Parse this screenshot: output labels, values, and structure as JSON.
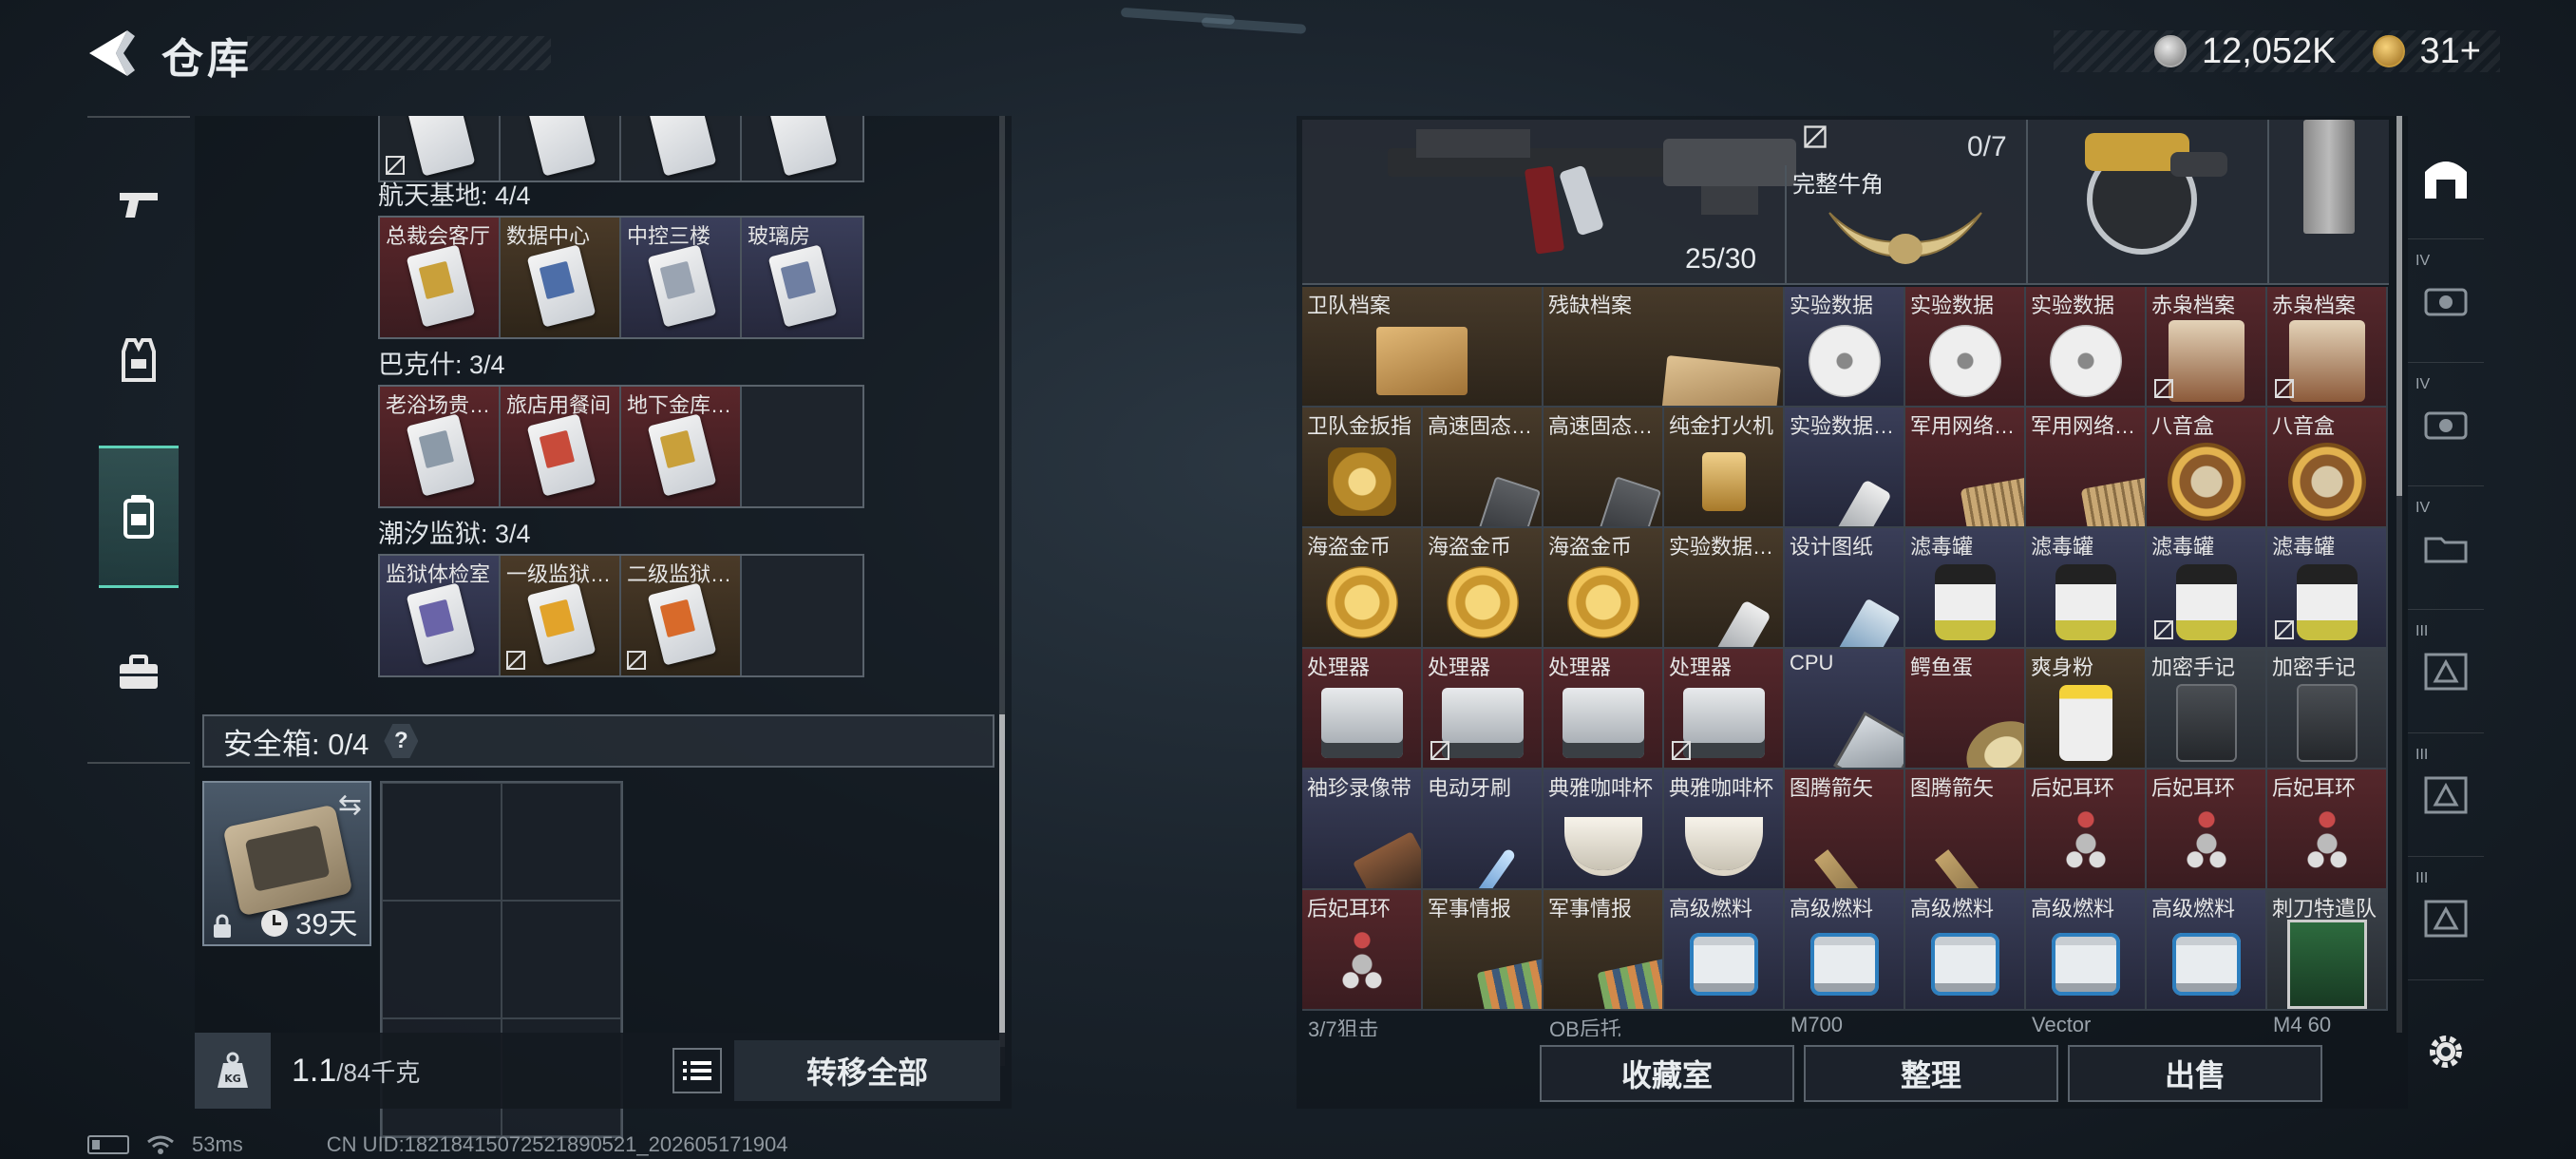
{
  "header": {
    "title": "仓库",
    "silver": "12,052K",
    "gold": "31+"
  },
  "left_nav": [
    {
      "id": "weapons",
      "icon": "gun-icon"
    },
    {
      "id": "gear",
      "icon": "vest-icon"
    },
    {
      "id": "backpack",
      "icon": "backpack-icon",
      "active": true
    },
    {
      "id": "toolkit",
      "icon": "toolbox-icon"
    }
  ],
  "keycard_sets": [
    {
      "title": "航天基地: 4/4",
      "cards": [
        {
          "name": "总裁会客厅",
          "bg": "red",
          "stripe": "#c9a03a"
        },
        {
          "name": "数据中心",
          "bg": "brown",
          "stripe": "#4d6ea8"
        },
        {
          "name": "中控三楼",
          "bg": "blue",
          "stripe": "#9aa4b2"
        },
        {
          "name": "玻璃房",
          "bg": "blue",
          "stripe": "#6f7fa2"
        }
      ]
    },
    {
      "title": "巴克什: 3/4",
      "cards": [
        {
          "name": "老浴场贵…",
          "bg": "red",
          "stripe": "#8c9aa8"
        },
        {
          "name": "旅店用餐间",
          "bg": "red",
          "stripe": "#c84b3a"
        },
        {
          "name": "地下金库…",
          "bg": "red",
          "stripe": "#c9a03a"
        },
        {
          "name": "",
          "bg": "empty"
        }
      ]
    },
    {
      "title": "潮汐监狱: 3/4",
      "cards": [
        {
          "name": "监狱体检室",
          "bg": "blue",
          "stripe": "#6a64a8"
        },
        {
          "name": "一级监狱…",
          "bg": "brown",
          "stripe": "#e2a32a",
          "no_trade": true
        },
        {
          "name": "二级监狱…",
          "bg": "brown",
          "stripe": "#d86a2a",
          "no_trade": true
        },
        {
          "name": "",
          "bg": "empty"
        }
      ]
    }
  ],
  "safebox": {
    "label": "安全箱: 0/4",
    "help": "?",
    "days": "39天"
  },
  "footer": {
    "weight": "1.1",
    "weight_max": "/84千克",
    "transfer_all": "转移全部"
  },
  "status": {
    "ping": "53ms",
    "uid": "CN UID:18218415072521890521_202605171904"
  },
  "stash_top": {
    "ammo": "25/30",
    "slot_count": "0/7",
    "horn_name": "完整牛角"
  },
  "stash_items": [
    {
      "name": "卫队档案",
      "bg": "b",
      "shape": "folder",
      "span": 2
    },
    {
      "name": "残缺档案",
      "bg": "b",
      "shape": "map",
      "span": 2
    },
    {
      "name": "实验数据",
      "bg": "u",
      "shape": "disc"
    },
    {
      "name": "实验数据",
      "bg": "r",
      "shape": "disc"
    },
    {
      "name": "实验数据",
      "bg": "r",
      "shape": "disc"
    },
    {
      "name": "赤枭档案",
      "bg": "r",
      "shape": "relic",
      "no_trade": true
    },
    {
      "name": "赤枭档案",
      "bg": "r",
      "shape": "relic",
      "no_trade": true
    },
    {
      "name": "卫队金扳指",
      "bg": "b",
      "shape": "ring"
    },
    {
      "name": "高速固态…",
      "bg": "b",
      "shape": "ssd"
    },
    {
      "name": "高速固态…",
      "bg": "b",
      "shape": "ssd"
    },
    {
      "name": "纯金打火机",
      "bg": "b",
      "shape": "lighter"
    },
    {
      "name": "实验数据…",
      "bg": "u",
      "shape": "usb"
    },
    {
      "name": "军用网络…",
      "bg": "r",
      "shape": "module"
    },
    {
      "name": "军用网络…",
      "bg": "r",
      "shape": "module"
    },
    {
      "name": "八音盒",
      "bg": "r",
      "shape": "musicbox"
    },
    {
      "name": "八音盒",
      "bg": "r",
      "shape": "musicbox"
    },
    {
      "name": "海盗金币",
      "bg": "b",
      "shape": "coin"
    },
    {
      "name": "海盗金币",
      "bg": "b",
      "shape": "coin"
    },
    {
      "name": "海盗金币",
      "bg": "b",
      "shape": "coin"
    },
    {
      "name": "实验数据…",
      "bg": "b",
      "shape": "usb"
    },
    {
      "name": "设计图纸",
      "bg": "u",
      "shape": "blueprint"
    },
    {
      "name": "滤毒罐",
      "bg": "u",
      "shape": "canister"
    },
    {
      "name": "滤毒罐",
      "bg": "u",
      "shape": "canister"
    },
    {
      "name": "滤毒罐",
      "bg": "u",
      "shape": "canister",
      "no_trade": true
    },
    {
      "name": "滤毒罐",
      "bg": "u",
      "shape": "canister",
      "no_trade": true
    },
    {
      "name": "处理器",
      "bg": "r",
      "shape": "cpu-pro"
    },
    {
      "name": "处理器",
      "bg": "r",
      "shape": "cpu-pro",
      "no_trade": true
    },
    {
      "name": "处理器",
      "bg": "r",
      "shape": "cpu-pro"
    },
    {
      "name": "处理器",
      "bg": "r",
      "shape": "cpu-pro",
      "no_trade": true
    },
    {
      "name": "CPU",
      "bg": "u",
      "shape": "cpu"
    },
    {
      "name": "鳄鱼蛋",
      "bg": "r",
      "shape": "egg"
    },
    {
      "name": "爽身粉",
      "bg": "b",
      "shape": "jar"
    },
    {
      "name": "加密手记",
      "bg": "g",
      "shape": "notebook"
    },
    {
      "name": "加密手记",
      "bg": "g",
      "shape": "notebook"
    },
    {
      "name": "袖珍录像带",
      "bg": "u",
      "shape": "tape"
    },
    {
      "name": "电动牙刷",
      "bg": "u",
      "shape": "brush"
    },
    {
      "name": "典雅咖啡杯",
      "bg": "u",
      "shape": "cup"
    },
    {
      "name": "典雅咖啡杯",
      "bg": "u",
      "shape": "cup"
    },
    {
      "name": "图腾箭矢",
      "bg": "r",
      "shape": "arrow"
    },
    {
      "name": "图腾箭矢",
      "bg": "r",
      "shape": "arrow"
    },
    {
      "name": "后妃耳环",
      "bg": "r",
      "shape": "earring"
    },
    {
      "name": "后妃耳环",
      "bg": "r",
      "shape": "earring"
    },
    {
      "name": "后妃耳环",
      "bg": "r",
      "shape": "earring"
    },
    {
      "name": "后妃耳环",
      "bg": "r",
      "shape": "earring"
    },
    {
      "name": "军事情报",
      "bg": "b",
      "shape": "intel"
    },
    {
      "name": "军事情报",
      "bg": "b",
      "shape": "intel"
    },
    {
      "name": "高级燃料",
      "bg": "u",
      "shape": "fuel"
    },
    {
      "name": "高级燃料",
      "bg": "u",
      "shape": "fuel"
    },
    {
      "name": "高级燃料",
      "bg": "u",
      "shape": "fuel"
    },
    {
      "name": "高级燃料",
      "bg": "u",
      "shape": "fuel"
    },
    {
      "name": "高级燃料",
      "bg": "u",
      "shape": "fuel"
    },
    {
      "name": "刺刀特遣队",
      "bg": "g",
      "shape": "poster"
    }
  ],
  "partial_names": [
    "3/7狙击",
    "QB后托",
    "M700",
    "Vector",
    "M4 60"
  ],
  "right_footer": {
    "collection": "收藏室",
    "sort": "整理",
    "sell": "出售"
  },
  "right_tabs": [
    "",
    "IV",
    "IV",
    "IV",
    "III",
    "III",
    "III"
  ]
}
